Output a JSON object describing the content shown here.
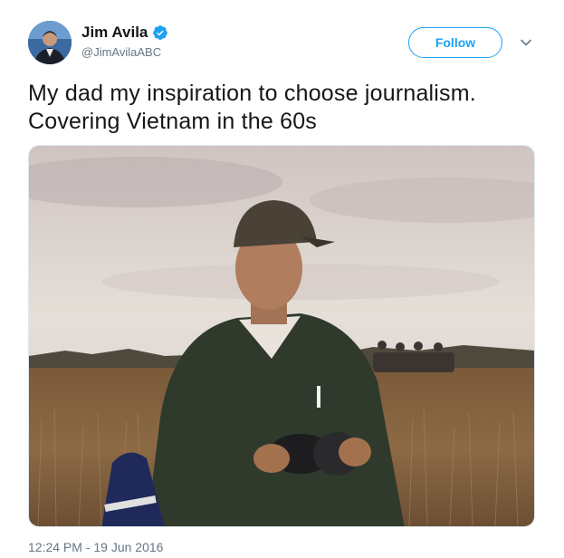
{
  "author": {
    "display_name": "Jim Avila",
    "handle": "@JimAvilaABC",
    "verified": true,
    "avatar_icon": "profile-photo"
  },
  "actions": {
    "follow_label": "Follow",
    "menu_icon": "chevron-down-icon"
  },
  "tweet": {
    "text": "My dad my inspiration to choose journalism. Covering Vietnam in the 60s",
    "timestamp": "12:24 PM - 19 Jun 2016"
  },
  "colors": {
    "accent": "#1da1f2",
    "secondary_text": "#657786",
    "primary_text": "#14171a"
  }
}
